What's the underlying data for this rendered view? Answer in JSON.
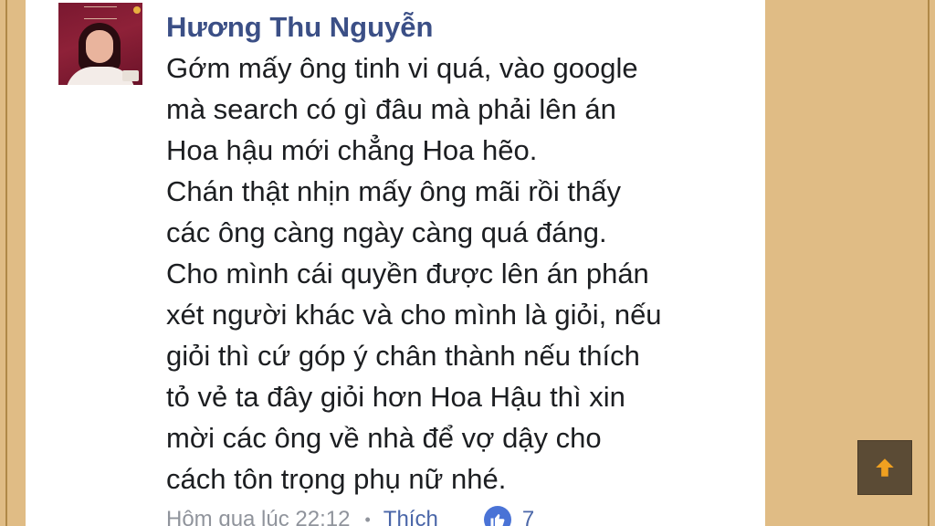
{
  "comment": {
    "author": "Hương Thu Nguyễn",
    "lines": [
      "Gớm mấy ông tinh vi quá, vào google",
      "mà search có gì đâu mà phải lên án",
      "Hoa hậu mới chẳng Hoa hẽo.",
      "Chán thật nhịn mấy ông mãi rồi thấy",
      "các ông càng ngày càng quá đáng.",
      "Cho mình cái quyền được lên án phán",
      "xét người khác và cho mình là giỏi, nếu",
      "giỏi thì cứ góp ý chân thành nếu thích",
      "tỏ vẻ ta đây giỏi hơn Hoa Hậu thì xin",
      "mời các ông về nhà để vợ dậy cho",
      "cách tôn trọng phụ nữ nhé."
    ],
    "timestamp": "Hôm qua lúc 22:12",
    "separator": "•",
    "like_label": "Thích",
    "like_count": "7"
  },
  "icons": {
    "avatar": "profile-photo",
    "like": "thumbs-up-icon",
    "scroll_top": "arrow-up-icon"
  },
  "colors": {
    "background": "#e0bc85",
    "author": "#3b4f86",
    "link": "#4a66a8",
    "like_badge": "#4a73d6",
    "scroll_button": "#5b4b35",
    "scroll_arrow": "#f0a020"
  }
}
